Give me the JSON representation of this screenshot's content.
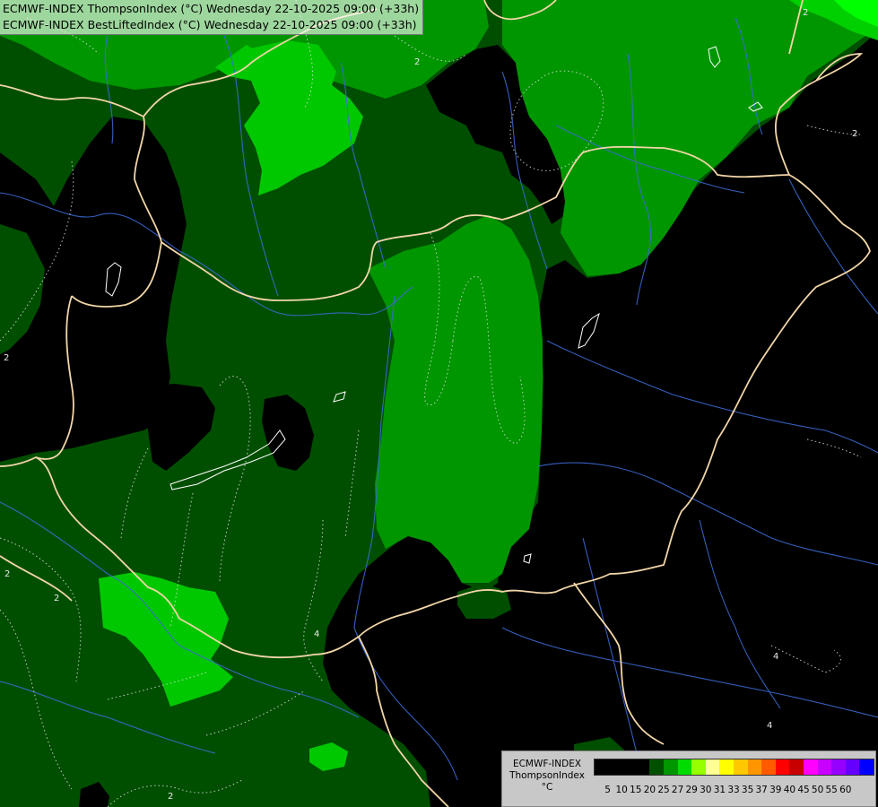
{
  "header": {
    "line1": "ECMWF-INDEX ThompsonIndex (°C) Wednesday 22-10-2025 09:00 (+33h)",
    "line2": "ECMWF-INDEX BestLiftedIndex (°C) Wednesday 22-10-2025 09:00 (+33h)"
  },
  "legend": {
    "title_line1": "ECMWF-INDEX",
    "title_line2": "ThompsonIndex",
    "title_line3": "°C",
    "swatches": [
      {
        "color": "#000000"
      },
      {
        "color": "#000000"
      },
      {
        "color": "#000000"
      },
      {
        "color": "#000000"
      },
      {
        "color": "#005000"
      },
      {
        "color": "#009600"
      },
      {
        "color": "#00dc00"
      },
      {
        "color": "#96ff00"
      },
      {
        "color": "#ffff96"
      },
      {
        "color": "#ffff00"
      },
      {
        "color": "#ffc800"
      },
      {
        "color": "#ff9600"
      },
      {
        "color": "#ff5a00"
      },
      {
        "color": "#ff0000"
      },
      {
        "color": "#c80000"
      },
      {
        "color": "#ff00ff"
      },
      {
        "color": "#c800ff"
      },
      {
        "color": "#9600ff"
      },
      {
        "color": "#6400ff"
      },
      {
        "color": "#0000ff"
      }
    ],
    "ticks": [
      "5",
      "10",
      "15",
      "20",
      "25",
      "27",
      "29",
      "30",
      "31",
      "33",
      "35",
      "37",
      "39",
      "40",
      "45",
      "50",
      "55",
      "60"
    ]
  },
  "contour_labels": [
    "2",
    "2",
    "2",
    "2",
    "2",
    "2",
    "4",
    "4",
    "4",
    "2"
  ],
  "colors": {
    "zone_black": "#000000",
    "zone_dark_green": "#004f00",
    "zone_mid_green": "#009600",
    "zone_light_green": "#00d000",
    "border_color": "#f2d6a8",
    "river_color": "#3b6ad0"
  }
}
